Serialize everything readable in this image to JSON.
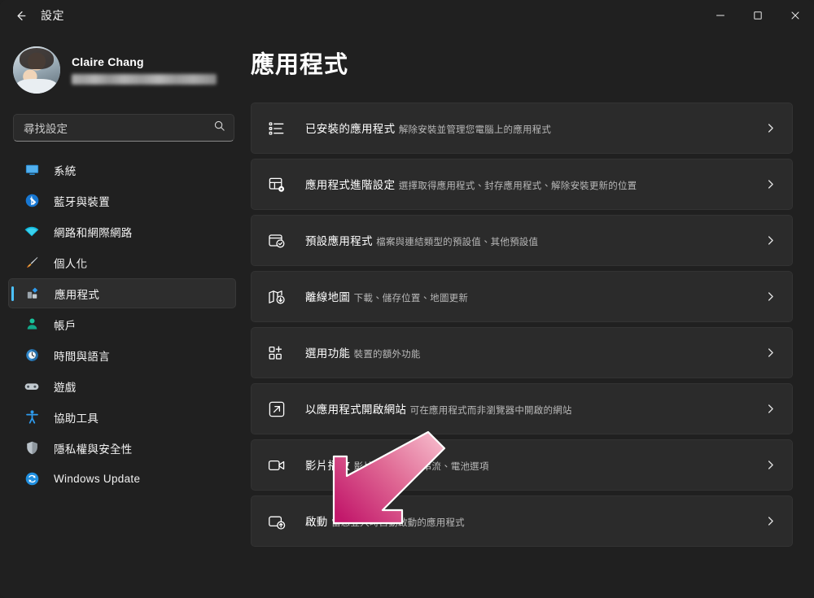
{
  "window": {
    "title": "設定",
    "back_icon": "arrow-left-icon",
    "controls": [
      {
        "name": "minimize",
        "glyph": "─"
      },
      {
        "name": "maximize",
        "glyph": "□"
      },
      {
        "name": "close",
        "glyph": "✕"
      }
    ]
  },
  "sidebar": {
    "profile": {
      "name": "Claire Chang",
      "email_redacted": true,
      "avatar_icon": "user-avatar"
    },
    "search": {
      "placeholder": "尋找設定",
      "value": "",
      "icon": "search-icon"
    },
    "items": [
      {
        "label": "系統",
        "icon": "system-icon",
        "selected": false
      },
      {
        "label": "藍牙與裝置",
        "icon": "bluetooth-icon",
        "selected": false
      },
      {
        "label": "網路和網際網路",
        "icon": "wifi-icon",
        "selected": false
      },
      {
        "label": "個人化",
        "icon": "paintbrush-icon",
        "selected": false
      },
      {
        "label": "應用程式",
        "icon": "apps-icon",
        "selected": true
      },
      {
        "label": "帳戶",
        "icon": "account-icon",
        "selected": false
      },
      {
        "label": "時間與語言",
        "icon": "clock-icon",
        "selected": false
      },
      {
        "label": "遊戲",
        "icon": "gamepad-icon",
        "selected": false
      },
      {
        "label": "協助工具",
        "icon": "accessibility-icon",
        "selected": false
      },
      {
        "label": "隱私權與安全性",
        "icon": "shield-icon",
        "selected": false
      },
      {
        "label": "Windows Update",
        "icon": "update-icon",
        "selected": false
      }
    ]
  },
  "main": {
    "title": "應用程式",
    "chevron_icon": "chevron-right-icon",
    "cards": [
      {
        "title": "已安裝的應用程式",
        "sub": "解除安裝並管理您電腦上的應用程式",
        "icon": "installed-apps-list-icon"
      },
      {
        "title": "應用程式進階設定",
        "sub": "選擇取得應用程式、封存應用程式、解除安裝更新的位置",
        "icon": "advanced-app-settings-icon"
      },
      {
        "title": "預設應用程式",
        "sub": "檔案與連結類型的預設值、其他預設值",
        "icon": "default-apps-icon"
      },
      {
        "title": "離線地圖",
        "sub": "下載、儲存位置、地圖更新",
        "icon": "offline-maps-icon"
      },
      {
        "title": "選用功能",
        "sub": "裝置的額外功能",
        "icon": "optional-features-icon"
      },
      {
        "title": "以應用程式開啟網站",
        "sub": "可在應用程式而非瀏覽器中開啟的網站",
        "icon": "open-websites-icon"
      },
      {
        "title": "影片播放",
        "sub": "影片調整、HDR串流、電池選項",
        "icon": "video-playback-icon"
      },
      {
        "title": "啟動",
        "sub": "當您登入時自動啟動的應用程式",
        "icon": "startup-icon"
      }
    ]
  },
  "annotation": {
    "arrow": {
      "icon": "pointer-arrow-icon",
      "direction": "down-left",
      "color_start": "#f2a6bd",
      "color_end": "#c2186b",
      "outline": "#ffffff",
      "points_at": "啟動"
    }
  },
  "theme": {
    "window_bg": "#202020",
    "card_bg": "#2b2b2b",
    "accent": "#4cc2ff",
    "text_primary": "#ffffff",
    "text_secondary": "#b8b8b8"
  }
}
